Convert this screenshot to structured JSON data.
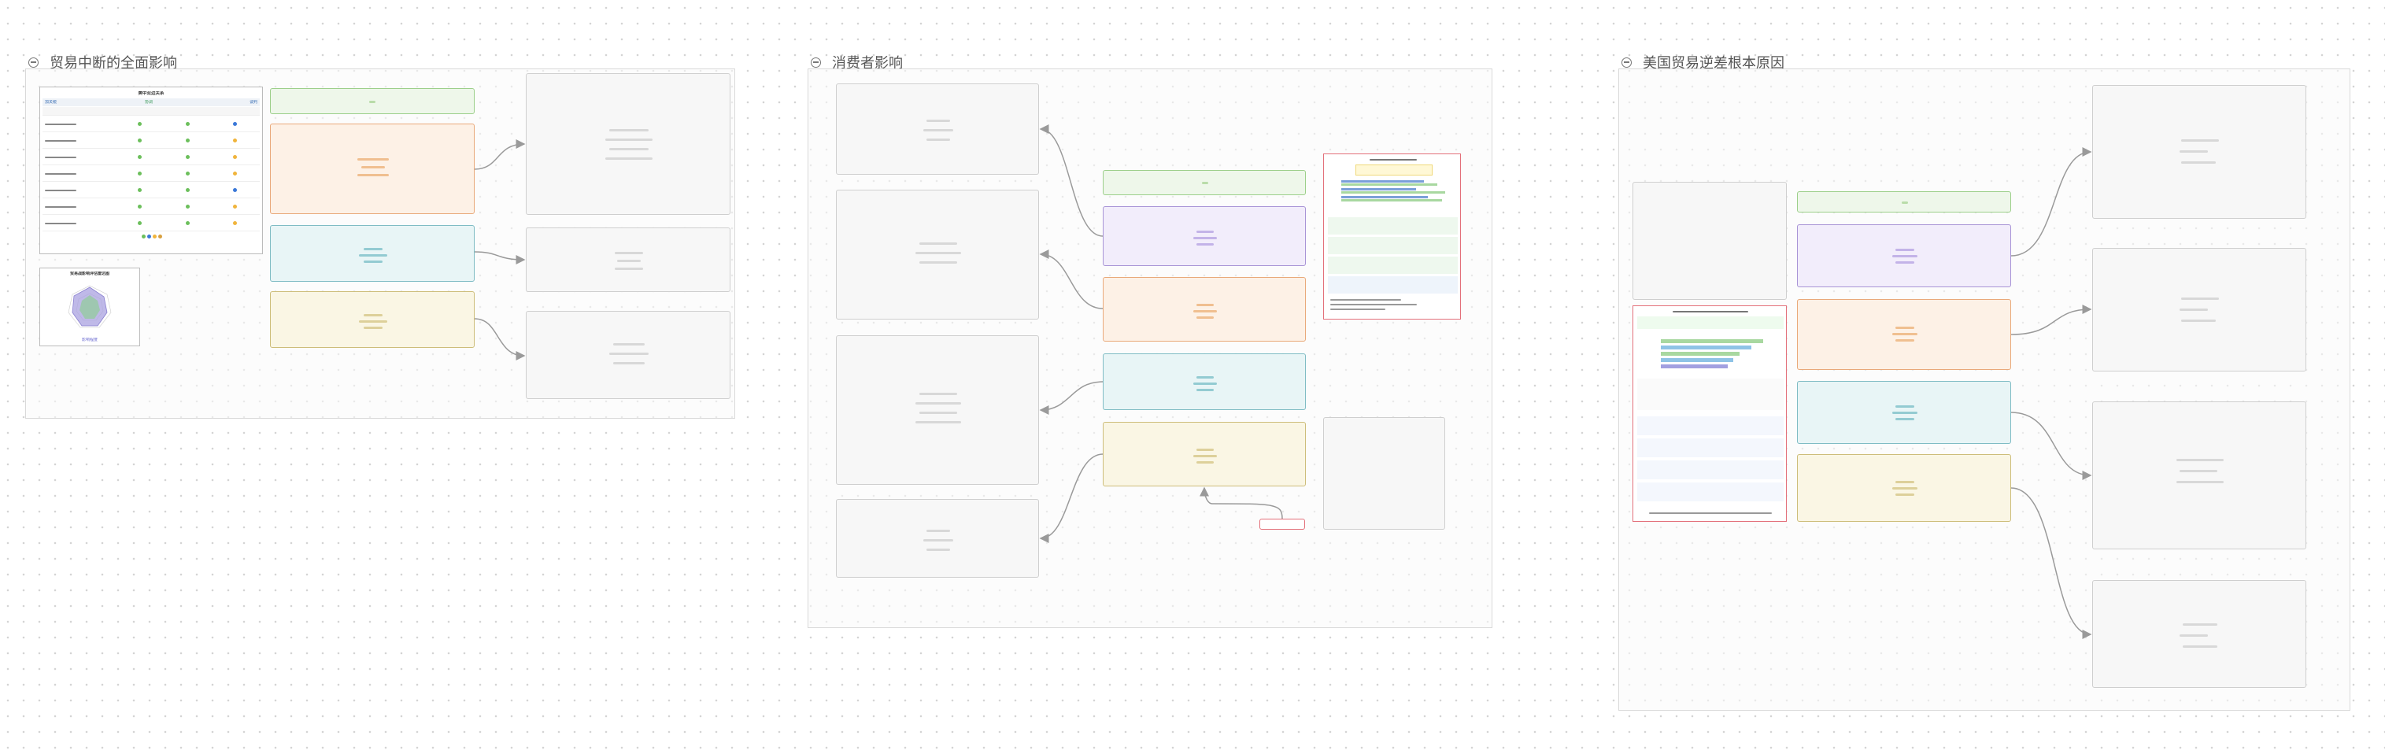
{
  "groups": [
    {
      "id": "g1",
      "title": "贸易中断的全面影响"
    },
    {
      "id": "g2",
      "title": "消费者影响"
    },
    {
      "id": "g3",
      "title": "美国贸易逆差根本原因"
    }
  ],
  "doc1": {
    "title": "美中双边关系",
    "sub_left": "加关税",
    "sub_mid": "协调",
    "sub_right": "谈判"
  },
  "radar": {
    "title": "贸易战影响评估雷达图",
    "legend": "影响程度"
  },
  "small_node_text": "小"
}
